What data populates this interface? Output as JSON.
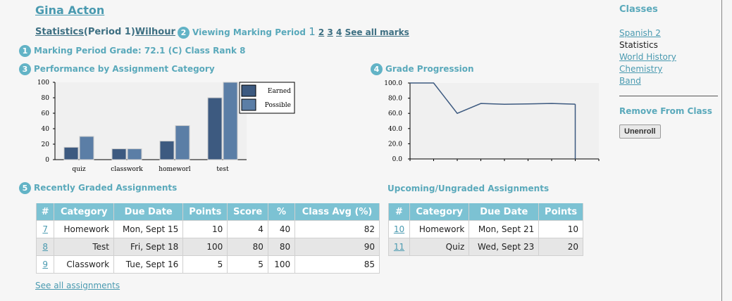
{
  "student": {
    "name": "Gina Acton"
  },
  "course": {
    "name": "Statistics",
    "period": "(Period 1)",
    "teacher": "Wilhour"
  },
  "viewing": {
    "label": "Viewing Marking Period",
    "current": "1",
    "others": [
      "2",
      "3",
      "4"
    ],
    "see_all": "See all marks"
  },
  "sections": {
    "grade": {
      "num": "1",
      "text": "Marking Period Grade: 72.1 (C) Class Rank 8"
    },
    "viewing_num": "2",
    "performance": {
      "num": "3",
      "title": "Performance by Assignment Category"
    },
    "progression": {
      "num": "4",
      "title": "Grade Progression"
    },
    "recent": {
      "num": "5",
      "title": "Recently Graded Assignments"
    },
    "upcoming": {
      "title": "Upcoming/Ungraded Assignments"
    }
  },
  "recent": {
    "headers": [
      "#",
      "Category",
      "Due Date",
      "Points",
      "Score",
      "%",
      "Class Avg (%)"
    ],
    "rows": [
      [
        "7",
        "Homework",
        "Mon, Sept 15",
        "10",
        "4",
        "40",
        "82"
      ],
      [
        "8",
        "Test",
        "Fri, Sept 18",
        "100",
        "80",
        "80",
        "90"
      ],
      [
        "9",
        "Classwork",
        "Tue, Sept 16",
        "5",
        "5",
        "100",
        "85"
      ]
    ],
    "see_all": "See all assignments"
  },
  "upcoming": {
    "headers": [
      "#",
      "Category",
      "Due Date",
      "Points"
    ],
    "rows": [
      [
        "10",
        "Homework",
        "Mon, Sept 21",
        "10"
      ],
      [
        "11",
        "Quiz",
        "Wed, Sept 23",
        "20"
      ]
    ]
  },
  "sidebar": {
    "title": "Classes",
    "classes": [
      {
        "label": "Spanish 2",
        "link": true
      },
      {
        "label": "Statistics",
        "link": false
      },
      {
        "label": "World History",
        "link": true
      },
      {
        "label": "Chemistry",
        "link": true
      },
      {
        "label": "Band",
        "link": true
      }
    ],
    "remove_title": "Remove From Class",
    "unenroll": "Unenroll"
  },
  "colors": {
    "earned": "#3d5a80",
    "possible": "#5b7ea6",
    "line": "#3d5a80",
    "accent": "#5aa9bb",
    "header": "#7cc2d3"
  },
  "chart_data": [
    {
      "type": "bar",
      "categories": [
        "quiz",
        "classwork",
        "homeworl",
        "test"
      ],
      "series": [
        {
          "name": "Earned",
          "values": [
            16,
            14,
            24,
            80
          ]
        },
        {
          "name": "Possible",
          "values": [
            30,
            14,
            44,
            100
          ]
        }
      ],
      "yticks": [
        "0",
        "20",
        "40",
        "60",
        "80",
        "100"
      ],
      "ylim": [
        0,
        100
      ],
      "legend": "top-right"
    },
    {
      "type": "line",
      "x": [
        1,
        2,
        3,
        4,
        5,
        6,
        7,
        8,
        9
      ],
      "series": [
        {
          "values": [
            100,
            100,
            60,
            73,
            72,
            72.5,
            73,
            72.1
          ]
        }
      ],
      "yticks": [
        "0.0",
        "20.0",
        "40.0",
        "60.0",
        "80.0",
        "100.0"
      ],
      "ylim": [
        0,
        100
      ]
    }
  ]
}
